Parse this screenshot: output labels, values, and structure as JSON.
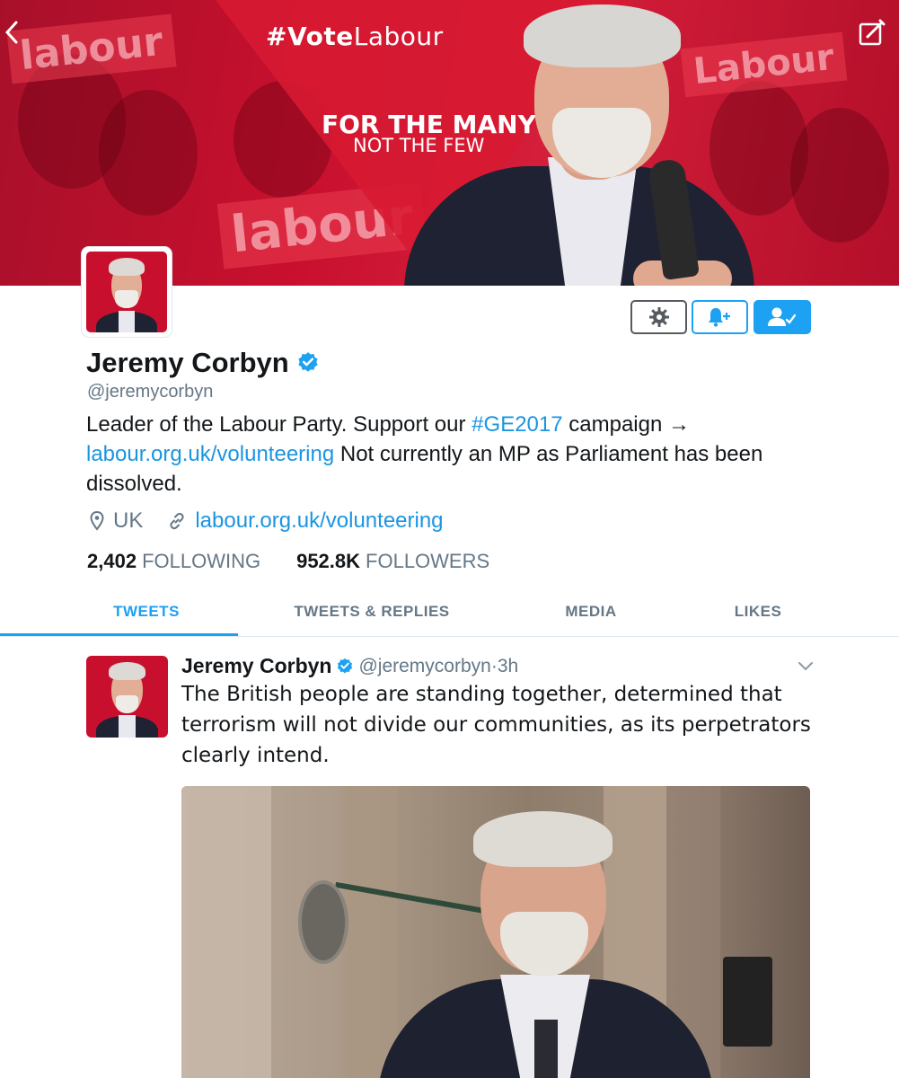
{
  "colors": {
    "accent": "#1da1f2",
    "link": "#1b95e0",
    "banner_red": "#c8102e",
    "muted_text": "#657786",
    "primary_text": "#14171a"
  },
  "nav": {
    "back_icon": "chevron-left-icon",
    "compose_icon": "compose-icon"
  },
  "banner": {
    "hashtag_bold": "#Vote",
    "hashtag_rest": "Labour",
    "slogan_line1": "FOR THE MANY",
    "slogan_line2": "NOT THE FEW"
  },
  "profile": {
    "name": "Jeremy Corbyn",
    "verified": true,
    "handle": "@jeremycorbyn",
    "bio_part1": "Leader of the Labour Party. Support our ",
    "bio_hashtag": "#GE2017",
    "bio_part2": " campaign →",
    "bio_link": "labour.org.uk/volunteering",
    "bio_part3": " Not currently an MP as Parliament has been dissolved.",
    "location": "UK",
    "website": "labour.org.uk/volunteering",
    "following_count": "2,402",
    "following_label": "FOLLOWING",
    "followers_count": "952.8K",
    "followers_label": "FOLLOWERS"
  },
  "actions": {
    "settings_icon": "gear-icon",
    "notifications_icon": "bell-plus-icon",
    "following_icon": "user-check-icon"
  },
  "tabs": [
    {
      "label": "TWEETS",
      "active": true
    },
    {
      "label": "TWEETS & REPLIES",
      "active": false
    },
    {
      "label": "MEDIA",
      "active": false
    },
    {
      "label": "LIKES",
      "active": false
    }
  ],
  "tweet": {
    "author_name": "Jeremy Corbyn",
    "author_handle": "@jeremycorbyn",
    "separator": " · ",
    "time": "3h",
    "text": "The British people are standing together, determined that terrorism will not divide our communities, as its perpetrators clearly intend."
  }
}
